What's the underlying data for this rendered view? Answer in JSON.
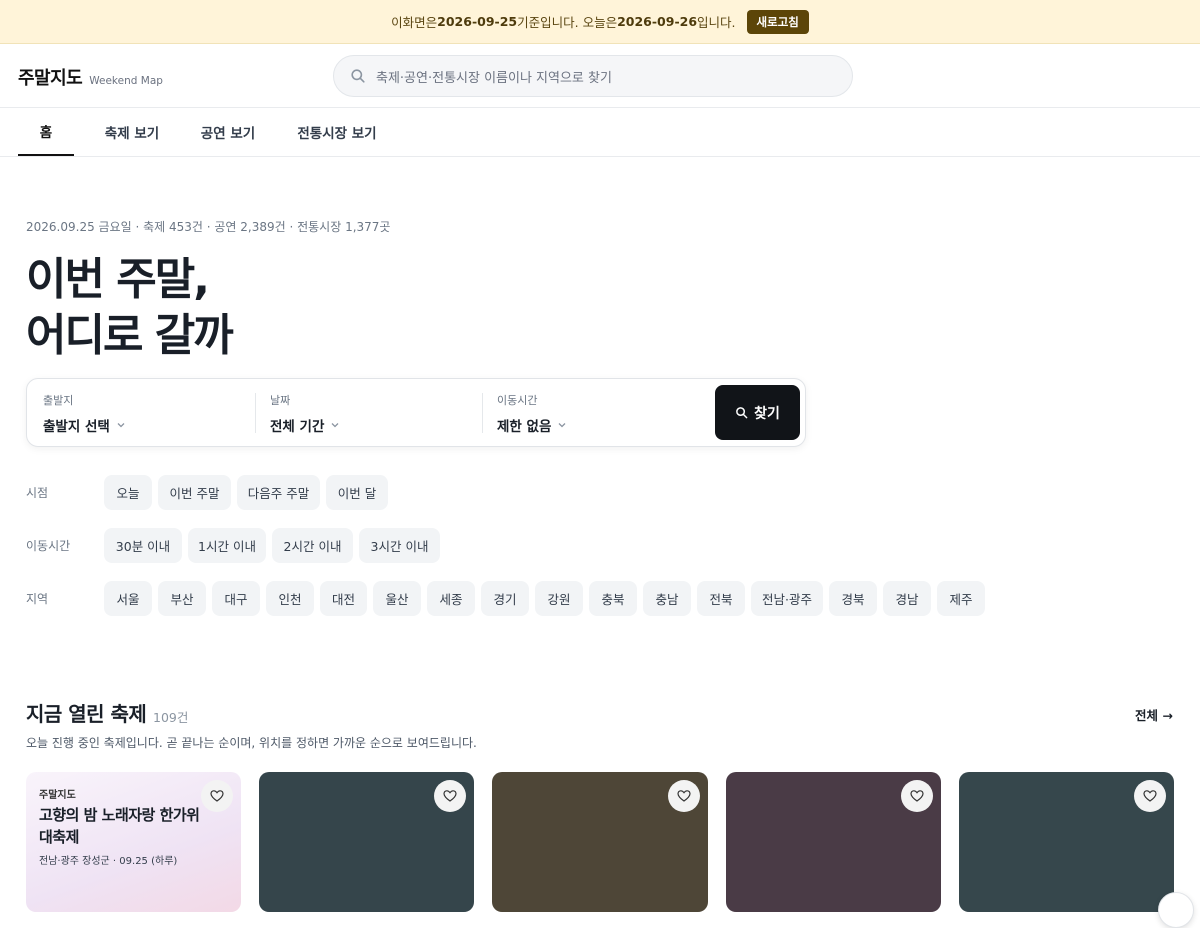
{
  "banner": {
    "prefix": "이화면은 ",
    "data_date": "2026-09-25",
    "middle": " 기준입니다. 오늘은 ",
    "today_date": "2026-09-26",
    "suffix": "입니다.",
    "refresh_label": "새로고침"
  },
  "header": {
    "logo_ko": "주말지도",
    "logo_en": "Weekend Map",
    "search_placeholder": "축제·공연·전통시장 이름이나 지역으로 찾기"
  },
  "nav": {
    "tabs": [
      {
        "label": "홈",
        "active": true
      },
      {
        "label": "축제 보기",
        "active": false
      },
      {
        "label": "공연 보기",
        "active": false
      },
      {
        "label": "전통시장 보기",
        "active": false
      }
    ]
  },
  "hero": {
    "meta": "2026.09.25 금요일 · 축제 453건 · 공연 2,389건 · 전통시장 1,377곳",
    "title_line1": "이번 주말,",
    "title_line2": "어디로 갈까"
  },
  "panel": {
    "origin_label": "출발지",
    "origin_value": "출발지 선택",
    "date_label": "날짜",
    "date_value": "전체 기간",
    "time_label": "이동시간",
    "time_value": "제한 없음",
    "find_label": "찾기"
  },
  "filters": {
    "when_label": "시점",
    "when": [
      "오늘",
      "이번 주말",
      "다음주 주말",
      "이번 달"
    ],
    "travel_label": "이동시간",
    "travel": [
      "30분 이내",
      "1시간 이내",
      "2시간 이내",
      "3시간 이내"
    ],
    "region_label": "지역",
    "regions": [
      "서울",
      "부산",
      "대구",
      "인천",
      "대전",
      "울산",
      "세종",
      "경기",
      "강원",
      "충북",
      "충남",
      "전북",
      "전남·광주",
      "경북",
      "경남",
      "제주"
    ]
  },
  "section": {
    "title": "지금 열린 축제",
    "count": "109건",
    "all_label": "전체 →",
    "description": "오늘 진행 중인 축제입니다. 곧 끝나는 순이며, 위치를 정하면 가까운 순으로 보여드립니다."
  },
  "cards": [
    {
      "brand": "주말지도",
      "title": "고향의 밤 노래자랑 한가위 대축제",
      "sub": "전남·광주 장성군 · 09.25 (하루)",
      "color": "#efe3f4"
    },
    {
      "color": "#35454b"
    },
    {
      "color": "#4e4637"
    },
    {
      "color": "#4a3b46"
    },
    {
      "color": "#36474c"
    }
  ]
}
